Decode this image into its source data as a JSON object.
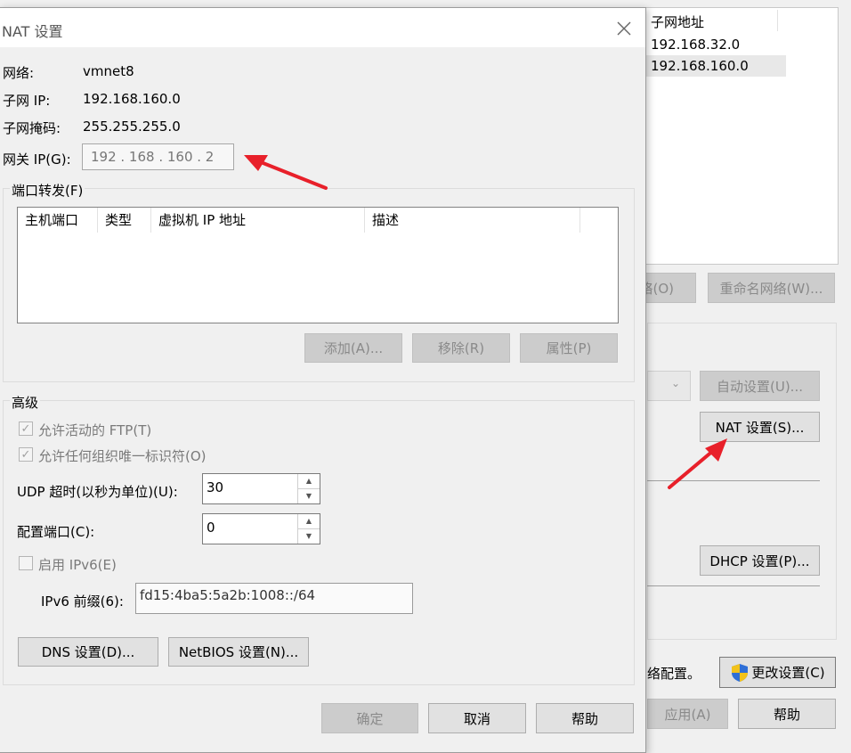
{
  "background_window": {
    "subnet_table": {
      "header": "子网地址",
      "rows": [
        "192.168.32.0",
        "192.168.160.0"
      ]
    },
    "buttons": {
      "partial_left": "络(O)",
      "rename_network": "重命名网络(W)...",
      "auto_settings": "自动设置(U)...",
      "nat_settings": "NAT 设置(S)...",
      "dhcp_settings": "DHCP 设置(P)...",
      "change_settings": "更改设置(C)",
      "apply": "应用(A)",
      "help": "帮助"
    },
    "notice_partial": "络配置。"
  },
  "dialog": {
    "title": "NAT 设置",
    "network_label": "网络:",
    "network_value": "vmnet8",
    "subnet_ip_label": "子网 IP:",
    "subnet_ip_value": "192.168.160.0",
    "subnet_mask_label": "子网掩码:",
    "subnet_mask_value": "255.255.255.0",
    "gateway_label": "网关 IP(G):",
    "gateway_value": "192 . 168 . 160 .  2",
    "port_forwarding": {
      "title": "端口转发(F)",
      "columns": [
        "主机端口",
        "类型",
        "虚拟机 IP 地址",
        "描述"
      ],
      "add": "添加(A)...",
      "remove": "移除(R)",
      "properties": "属性(P)"
    },
    "advanced": {
      "title": "高级",
      "allow_ftp": "允许活动的 FTP(T)",
      "allow_oui": "允许任何组织唯一标识符(O)",
      "udp_timeout_label": "UDP 超时(以秒为单位)(U):",
      "udp_timeout_value": "30",
      "config_port_label": "配置端口(C):",
      "config_port_value": "0",
      "enable_ipv6": "启用 IPv6(E)",
      "ipv6_prefix_label": "IPv6 前缀(6):",
      "ipv6_prefix_value": "fd15:4ba5:5a2b:1008::/64",
      "dns_button": "DNS 设置(D)...",
      "netbios_button": "NetBIOS 设置(N)..."
    },
    "footer": {
      "ok": "确定",
      "cancel": "取消",
      "help": "帮助"
    }
  },
  "colors": {
    "annotation_arrow": "#e8202a",
    "shield_blue": "#2f6fd6",
    "shield_yellow": "#f2c21b"
  }
}
